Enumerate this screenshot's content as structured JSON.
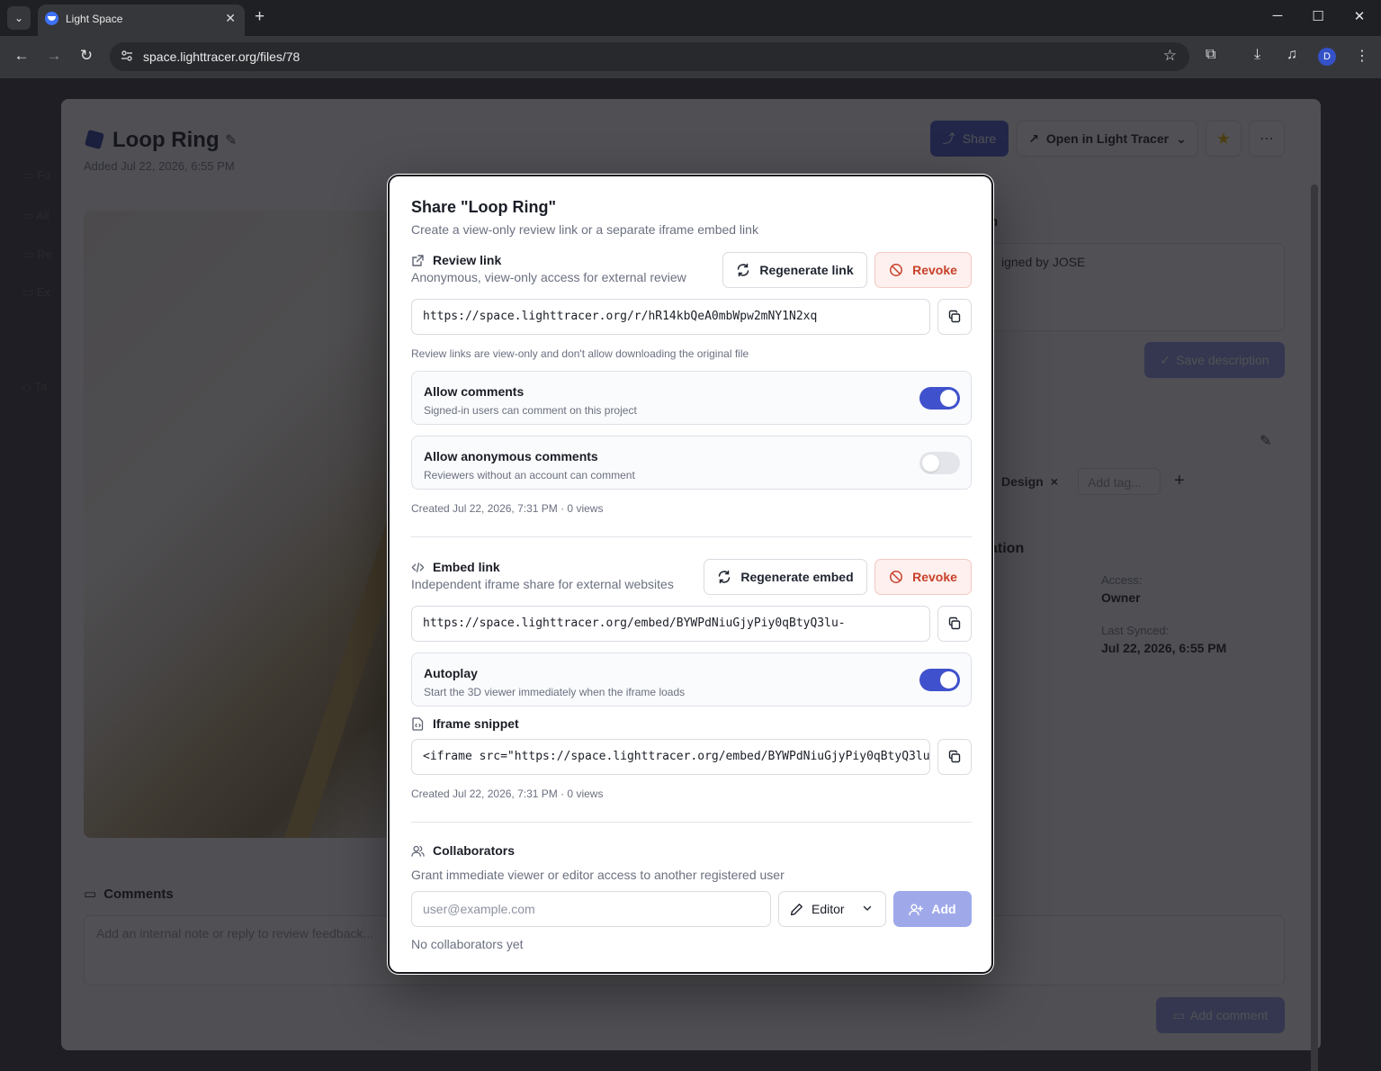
{
  "browser": {
    "tab_title": "Light Space",
    "url": "space.lighttracer.org/files/78",
    "avatar_letter": "D"
  },
  "page": {
    "title": "Loop Ring",
    "added": "Added Jul 22, 2026, 6:55 PM",
    "share_label": "Share",
    "open_label": "Open in Light Tracer",
    "description_label": "n",
    "description_text": "igned by JOSE",
    "save_description_label": "Save description",
    "tag_design": "Design",
    "tag_placeholder": "Add tag...",
    "info_title": "ation",
    "access_label": "Access:",
    "access_value": "Owner",
    "last_synced_label": "Last Synced:",
    "last_synced_value": "Jul 22, 2026, 6:55 PM",
    "comments_title": "Comments",
    "comment_placeholder": "Add an internal note or reply to review feedback...",
    "add_comment_label": "Add comment"
  },
  "modal": {
    "title": "Share \"Loop Ring\"",
    "subtitle": "Create a view-only review link or a separate iframe embed link",
    "review": {
      "title": "Review link",
      "subtitle": "Anonymous, view-only access for external review",
      "regenerate_label": "Regenerate link",
      "revoke_label": "Revoke",
      "url": "https://space.lighttracer.org/r/hR14kbQeA0mbWpw2mNY1N2xq",
      "note": "Review links are view-only and don't allow downloading the original file",
      "allow_comments_title": "Allow comments",
      "allow_comments_sub": "Signed-in users can comment on this project",
      "allow_comments_on": true,
      "allow_anon_title": "Allow anonymous comments",
      "allow_anon_sub": "Reviewers without an account can comment",
      "allow_anon_on": false,
      "created": "Created Jul 22, 2026, 7:31 PM · 0 views"
    },
    "embed": {
      "title": "Embed link",
      "subtitle": "Independent iframe share for external websites",
      "regenerate_label": "Regenerate embed",
      "revoke_label": "Revoke",
      "url": "https://space.lighttracer.org/embed/BYWPdNiuGjyPiy0qBtyQ3lu-",
      "autoplay_title": "Autoplay",
      "autoplay_sub": "Start the 3D viewer immediately when the iframe loads",
      "autoplay_on": true,
      "snippet_title": "Iframe snippet",
      "snippet": "<iframe src=\"https://space.lighttracer.org/embed/BYWPdNiuGjyPiy0qBtyQ3lu",
      "created": "Created Jul 22, 2026, 7:31 PM · 0 views"
    },
    "collaborators": {
      "title": "Collaborators",
      "subtitle": "Grant immediate viewer or editor access to another registered user",
      "email_placeholder": "user@example.com",
      "role_value": "Editor",
      "add_label": "Add",
      "empty_text": "No collaborators yet"
    }
  },
  "colors": {
    "accent": "#3f51cc",
    "danger": "#c8412b",
    "danger_bg": "#fdf0ee"
  },
  "icons": [
    "chevron-down-icon",
    "close-icon",
    "plus-icon",
    "back-icon",
    "forward-icon",
    "reload-icon",
    "site-info-icon",
    "bookmark-star-icon",
    "extensions-icon",
    "download-icon",
    "media-icon",
    "menu-icon",
    "external-link-icon",
    "refresh-icon",
    "ban-icon",
    "copy-icon",
    "code-icon",
    "file-code-icon",
    "users-icon",
    "pencil-icon",
    "user-plus-icon"
  ]
}
